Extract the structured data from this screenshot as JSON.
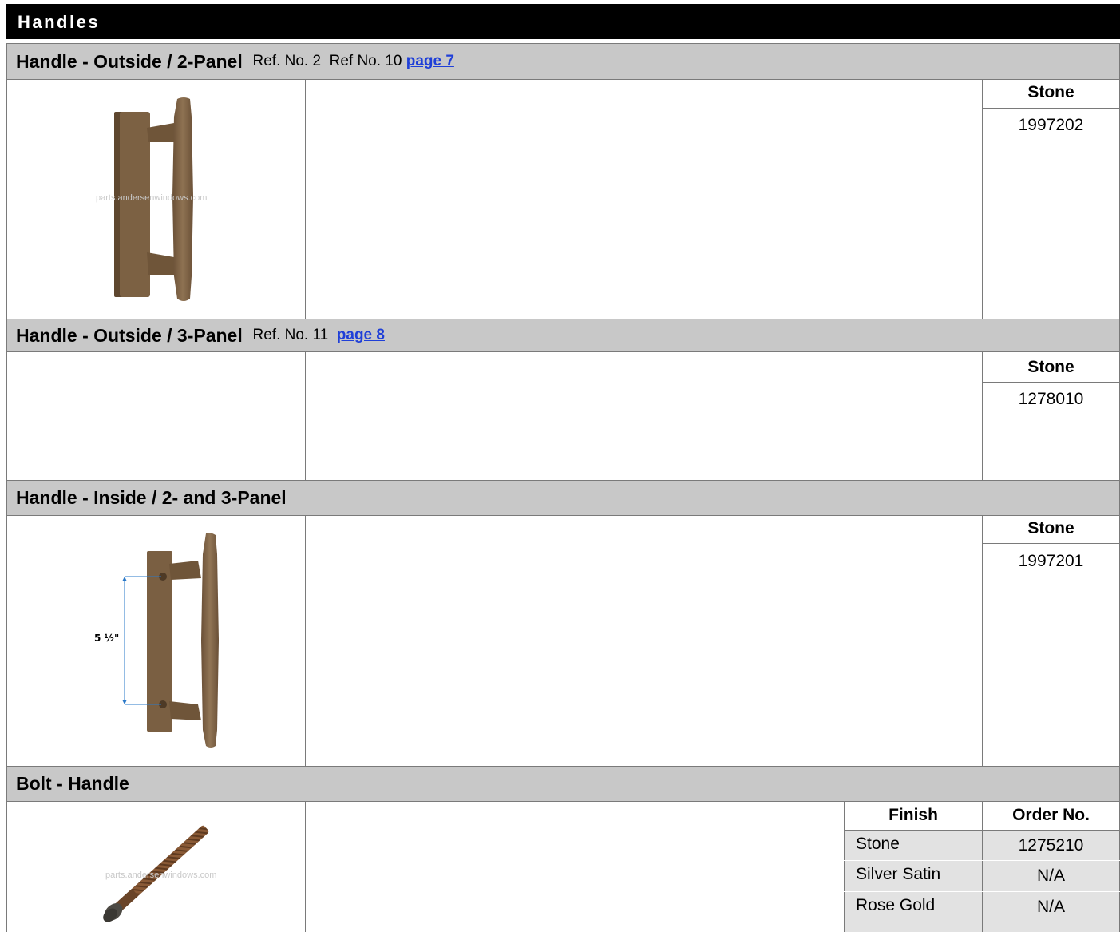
{
  "title": "Handles",
  "sections": [
    {
      "name": "Handle - Outside / 2-Panel",
      "ref": "Ref. No. 2  Ref No. 10 ",
      "link": "page 7",
      "finish_header": "Stone",
      "order_no": "1997202",
      "watermark": "parts.andersenwindows.com"
    },
    {
      "name": "Handle - Outside / 3-Panel",
      "ref": "Ref. No. 11  ",
      "link": "page 8",
      "finish_header": "Stone",
      "order_no": "1278010"
    },
    {
      "name": "Handle - Inside / 2- and 3-Panel",
      "finish_header": "Stone",
      "order_no": "1997201",
      "dimension": "5 ½\""
    },
    {
      "name": "Bolt - Handle",
      "watermark": "parts.andersenwindows.com",
      "table": {
        "headers": [
          "Finish",
          "Order No."
        ],
        "rows": [
          [
            "Stone",
            "1275210"
          ],
          [
            "Silver Satin",
            "N/A"
          ],
          [
            "Rose Gold",
            "N/A"
          ]
        ]
      }
    }
  ],
  "colors": {
    "header_bg": "#000000",
    "section_bg": "#c8c8c8",
    "link": "#1f3fd8",
    "bronze": "#7e6345",
    "dimension_line": "#2a78c8"
  }
}
